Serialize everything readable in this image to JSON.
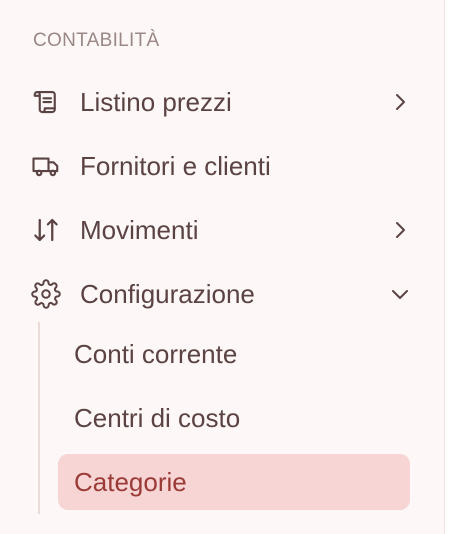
{
  "sidebar": {
    "section_title": "CONTABILITÀ",
    "items": [
      {
        "label": "Listino prezzi",
        "icon": "scroll-icon",
        "chevron": "chevron-right-icon"
      },
      {
        "label": "Fornitori e clienti",
        "icon": "truck-icon"
      },
      {
        "label": "Movimenti",
        "icon": "arrows-up-down-icon",
        "chevron": "chevron-right-icon"
      },
      {
        "label": "Configurazione",
        "icon": "gear-icon",
        "chevron": "chevron-down-icon"
      }
    ],
    "subitems": [
      {
        "label": "Conti corrente",
        "active": false
      },
      {
        "label": "Centri di costo",
        "active": false
      },
      {
        "label": "Categorie",
        "active": true
      }
    ]
  },
  "colors": {
    "sidebar_bg": "#fdf8f7",
    "text": "#5b4243",
    "section_title": "#9a8786",
    "active_bg": "#f7d5d4",
    "active_text": "#9b3b38"
  }
}
